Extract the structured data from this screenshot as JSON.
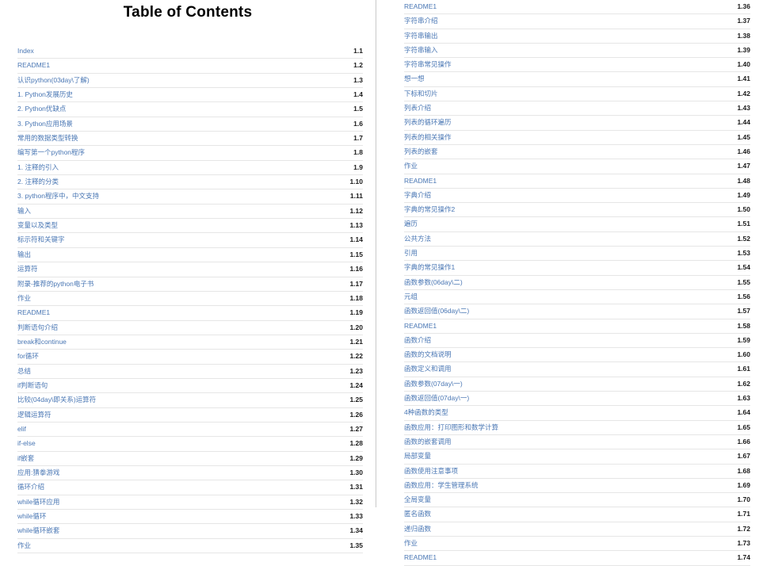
{
  "document": {
    "title": "Table of Contents"
  },
  "colors": {
    "link": "#4a77b4",
    "page_number": "#1a1a1a",
    "divider": "#e6e6e6",
    "column_rule": "#c9c9c9",
    "background": "#ffffff"
  },
  "left_column": {
    "entries": [
      {
        "label": "Index",
        "page": "1.1"
      },
      {
        "label": "README1",
        "page": "1.2"
      },
      {
        "label": "认识python(03day\\了解)",
        "page": "1.3"
      },
      {
        "label": "1. Python发展历史",
        "page": "1.4"
      },
      {
        "label": "2. Python优缺点",
        "page": "1.5"
      },
      {
        "label": "3. Python应用场景",
        "page": "1.6"
      },
      {
        "label": "常用的数据类型转换",
        "page": "1.7"
      },
      {
        "label": "编写第一个python程序",
        "page": "1.8"
      },
      {
        "label": "1. 注释的引入",
        "page": "1.9"
      },
      {
        "label": "2. 注释的分类",
        "page": "1.10"
      },
      {
        "label": "3. python程序中，中文支持",
        "page": "1.11"
      },
      {
        "label": "输入",
        "page": "1.12"
      },
      {
        "label": "变量以及类型",
        "page": "1.13"
      },
      {
        "label": "标示符和关键字",
        "page": "1.14"
      },
      {
        "label": "输出",
        "page": "1.15"
      },
      {
        "label": "运算符",
        "page": "1.16"
      },
      {
        "label": "附录-推荐的python电子书",
        "page": "1.17"
      },
      {
        "label": "作业",
        "page": "1.18"
      },
      {
        "label": "README1",
        "page": "1.19"
      },
      {
        "label": "判断语句介绍",
        "page": "1.20"
      },
      {
        "label": "break和continue",
        "page": "1.21"
      },
      {
        "label": "for循环",
        "page": "1.22"
      },
      {
        "label": "总结",
        "page": "1.23"
      },
      {
        "label": "if判断语句",
        "page": "1.24"
      },
      {
        "label": "比较(04day\\即关系)运算符",
        "page": "1.25"
      },
      {
        "label": "逻辑运算符",
        "page": "1.26"
      },
      {
        "label": "elif",
        "page": "1.27"
      },
      {
        "label": "if-else",
        "page": "1.28"
      },
      {
        "label": "if嵌套",
        "page": "1.29"
      },
      {
        "label": "应用:猜拳游戏",
        "page": "1.30"
      },
      {
        "label": "循环介绍",
        "page": "1.31"
      },
      {
        "label": "while循环应用",
        "page": "1.32"
      },
      {
        "label": "while循环",
        "page": "1.33"
      },
      {
        "label": "while循环嵌套",
        "page": "1.34"
      },
      {
        "label": "作业",
        "page": "1.35"
      }
    ]
  },
  "right_column": {
    "entries": [
      {
        "label": "README1",
        "page": "1.36"
      },
      {
        "label": "字符串介绍",
        "page": "1.37"
      },
      {
        "label": "字符串输出",
        "page": "1.38"
      },
      {
        "label": "字符串输入",
        "page": "1.39"
      },
      {
        "label": "字符串常见操作",
        "page": "1.40"
      },
      {
        "label": "想一想",
        "page": "1.41"
      },
      {
        "label": "下标和切片",
        "page": "1.42"
      },
      {
        "label": "列表介绍",
        "page": "1.43"
      },
      {
        "label": "列表的循环遍历",
        "page": "1.44"
      },
      {
        "label": "列表的相关操作",
        "page": "1.45"
      },
      {
        "label": "列表的嵌套",
        "page": "1.46"
      },
      {
        "label": "作业",
        "page": "1.47"
      },
      {
        "label": "README1",
        "page": "1.48"
      },
      {
        "label": "字典介绍",
        "page": "1.49"
      },
      {
        "label": "字典的常见操作2",
        "page": "1.50"
      },
      {
        "label": "遍历",
        "page": "1.51"
      },
      {
        "label": "公共方法",
        "page": "1.52"
      },
      {
        "label": "引用",
        "page": "1.53"
      },
      {
        "label": "字典的常见操作1",
        "page": "1.54"
      },
      {
        "label": "函数参数(06day\\二)",
        "page": "1.55"
      },
      {
        "label": "元组",
        "page": "1.56"
      },
      {
        "label": "函数返回值(06day\\二)",
        "page": "1.57"
      },
      {
        "label": "README1",
        "page": "1.58"
      },
      {
        "label": "函数介绍",
        "page": "1.59"
      },
      {
        "label": "函数的文档说明",
        "page": "1.60"
      },
      {
        "label": "函数定义和调用",
        "page": "1.61"
      },
      {
        "label": "函数参数(07day\\一)",
        "page": "1.62"
      },
      {
        "label": "函数返回值(07day\\一)",
        "page": "1.63"
      },
      {
        "label": "4种函数的类型",
        "page": "1.64"
      },
      {
        "label": "函数应用：打印图形和数学计算",
        "page": "1.65"
      },
      {
        "label": "函数的嵌套调用",
        "page": "1.66"
      },
      {
        "label": "局部变量",
        "page": "1.67"
      },
      {
        "label": "函数使用注意事项",
        "page": "1.68"
      },
      {
        "label": "函数应用：学生管理系统",
        "page": "1.69"
      },
      {
        "label": "全局变量",
        "page": "1.70"
      },
      {
        "label": "匿名函数",
        "page": "1.71"
      },
      {
        "label": "递归函数",
        "page": "1.72"
      },
      {
        "label": "作业",
        "page": "1.73"
      },
      {
        "label": "README1",
        "page": "1.74"
      }
    ]
  }
}
